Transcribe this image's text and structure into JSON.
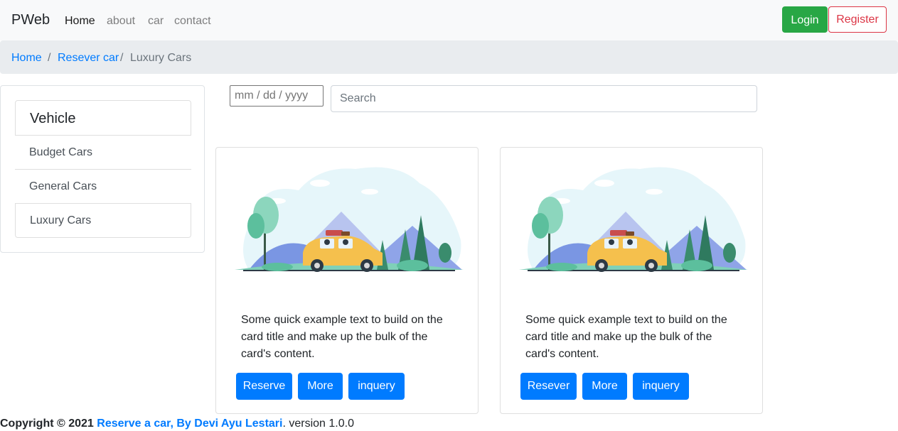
{
  "navbar": {
    "brand": "PWeb",
    "links": [
      "Home",
      "about",
      "car",
      "contact"
    ],
    "login_label": "Login",
    "register_label": "Register"
  },
  "breadcrumb": {
    "items": [
      "Home",
      "Resever car",
      "Luxury Cars"
    ],
    "separator": "/"
  },
  "sidebar": {
    "title": "Vehicle",
    "items": [
      "Budget Cars",
      "General Cars",
      "Luxury Cars"
    ]
  },
  "filters": {
    "date_placeholder": "mm / dd / yyyy",
    "search_placeholder": "Search"
  },
  "cards": [
    {
      "text": "Some quick example text to build on the card title and make up the bulk of the card's content.",
      "buttons": [
        "Reserve",
        "More",
        "inquery"
      ]
    },
    {
      "text": "Some quick example text to build on the card title and make up the bulk of the card's content.",
      "buttons": [
        "Resever",
        "More",
        "inquery"
      ]
    }
  ],
  "footer": {
    "copyright": "Copyright © 2021",
    "author": "Reserve a car, By Devi Ayu Lestari",
    "suffix": ". version 1.0.0"
  },
  "colors": {
    "primary": "#007bff",
    "success": "#28a745",
    "danger": "#dc3545",
    "navbar_bg": "#f8f9fa",
    "breadcrumb_bg": "#e9ecef"
  }
}
